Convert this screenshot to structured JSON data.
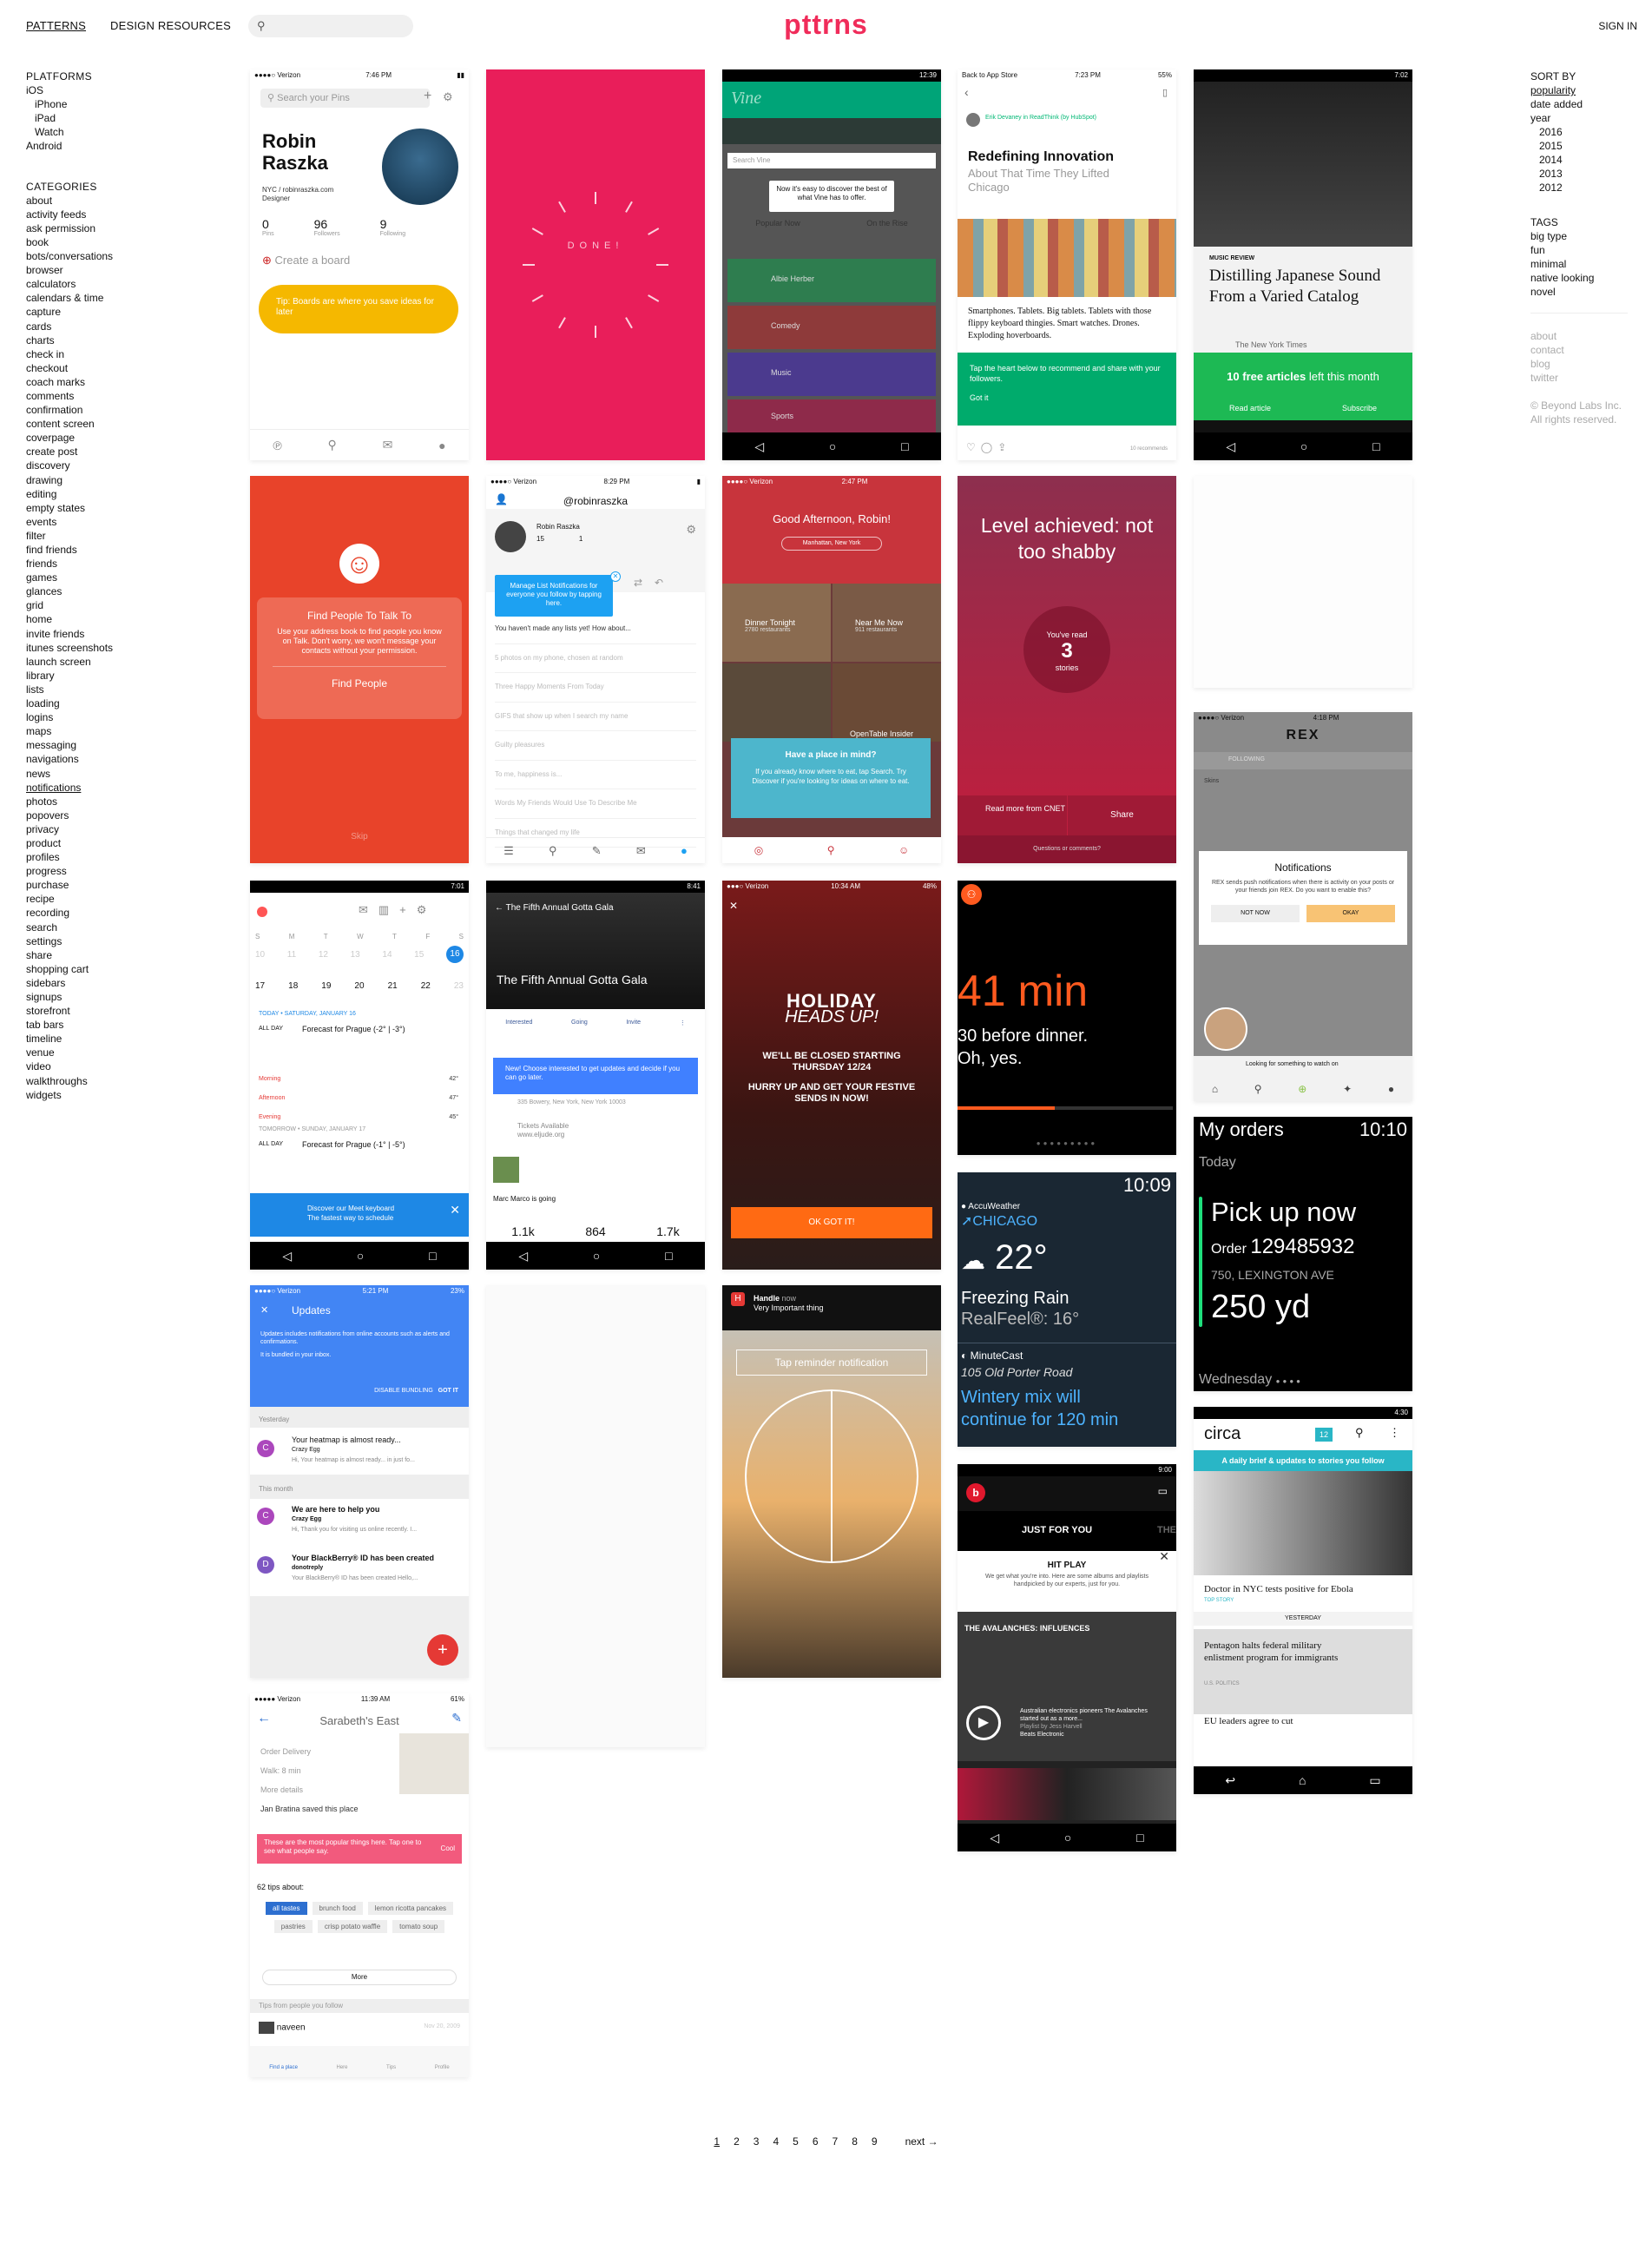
{
  "header": {
    "tab_patterns": "PATTERNS",
    "tab_resources": "DESIGN RESOURCES",
    "logo": "pttrns",
    "signin": "SIGN IN"
  },
  "platforms": {
    "heading": "PLATFORMS",
    "items": [
      "iOS",
      "iPhone",
      "iPad",
      "Watch",
      "Android"
    ]
  },
  "categories": {
    "heading": "CATEGORIES",
    "items": [
      "about",
      "activity feeds",
      "ask permission",
      "book",
      "bots/conversations",
      "browser",
      "calculators",
      "calendars & time",
      "capture",
      "cards",
      "charts",
      "check in",
      "checkout",
      "coach marks",
      "comments",
      "confirmation",
      "content screen",
      "coverpage",
      "create post",
      "discovery",
      "drawing",
      "editing",
      "empty states",
      "events",
      "filter",
      "find friends",
      "friends",
      "games",
      "glances",
      "grid",
      "home",
      "invite friends",
      "itunes screenshots",
      "launch screen",
      "library",
      "lists",
      "loading",
      "logins",
      "maps",
      "messaging",
      "navigations",
      "news",
      "notifications",
      "photos",
      "popovers",
      "privacy",
      "product",
      "profiles",
      "progress",
      "purchase",
      "recipe",
      "recording",
      "search",
      "settings",
      "share",
      "shopping cart",
      "sidebars",
      "signups",
      "storefront",
      "tab bars",
      "timeline",
      "venue",
      "video",
      "walkthroughs",
      "widgets"
    ],
    "selected": "notifications"
  },
  "sort": {
    "heading": "SORT BY",
    "items": [
      "popularity",
      "date added",
      "year"
    ],
    "years": [
      "2016",
      "2015",
      "2014",
      "2013",
      "2012"
    ]
  },
  "tags": {
    "heading": "TAGS",
    "items": [
      "big type",
      "fun",
      "minimal",
      "native looking",
      "novel"
    ]
  },
  "footer_links": [
    "about",
    "contact",
    "blog",
    "twitter"
  ],
  "copyright": [
    "© Beyond Labs Inc.",
    "All rights reserved."
  ],
  "pagination": {
    "pages": [
      "1",
      "2",
      "3",
      "4",
      "5",
      "6",
      "7",
      "8",
      "9"
    ],
    "next": "next →"
  },
  "colors": {
    "brand": "#f02c5a"
  },
  "shots": {
    "pinterest": {
      "time": "7:46 PM",
      "search": "Search your Pins",
      "name1": "Robin",
      "name2": "Raszka",
      "site": "NYC / robinraszka.com",
      "role": "Designer",
      "s1": "0",
      "s1l": "Pins",
      "s2": "96",
      "s2l": "Followers",
      "s3": "9",
      "s3l": "Following",
      "create": "Create a board",
      "tip": "Tip: Boards are where you save ideas for later"
    },
    "done": {
      "text": "DONE!"
    },
    "vine": {
      "time": "12:39",
      "search": "Search Vine",
      "tip": "Now it's easy to discover the best of what Vine has to offer.",
      "tab1": "Popular Now",
      "tab2": "On the Rise",
      "ch": [
        "Albie Herber",
        "Comedy",
        "Music",
        "Sports"
      ]
    },
    "medium": {
      "time": "7:23 PM",
      "back": "Back to App Store",
      "author": "Erik Devaney in ReadThink (by HubSpot)",
      "title": "Redefining Innovation",
      "sub": "About That Time They Lifted Chicago",
      "body": "Smartphones. Tablets. Big tablets. Tablets with those flippy keyboard thingies. Smart watches. Drones. Exploding hoverboards.",
      "tip": "Tap the heart below to recommend and share with your followers.",
      "got": "Got it",
      "rec": "10 recommends"
    },
    "nyt": {
      "time": "7:02",
      "kicker": "MUSIC REVIEW",
      "title": "Distilling Japanese Sound From a Varied Catalog",
      "src": "The New York Times",
      "banner1": "10 free articles",
      "banner2": "left this month",
      "read": "Read article",
      "sub": "Subscribe"
    },
    "talk": {
      "title": "Find People To Talk To",
      "body": "Use your address book to find people you know on Talk. Don't worry, we won't message your contacts without your permission.",
      "btn": "Find People",
      "skip": "Skip"
    },
    "twitter": {
      "time": "8:29 PM",
      "handle": "@robinraszka",
      "name": "Robin Raszka",
      "n1": "15",
      "n2": "1",
      "tip": "Manage List Notifications for everyone you follow by tapping here.",
      "lines": [
        "You haven't made any lists yet! How about...",
        "5 photos on my phone, chosen at random",
        "Three Happy Moments From Today",
        "GIFS that show up when I search my name",
        "Guilty pleasures",
        "To me, happiness is...",
        "Words My Friends Would Use To Describe Me",
        "Things that changed my life"
      ]
    },
    "opentable": {
      "time": "2:47 PM",
      "greet": "Good Afternoon, Robin!",
      "loc": "Manhattan, New York",
      "t1": "Dinner Tonight",
      "t1s": "2780 restaurants",
      "t2": "Near Me Now",
      "t2s": "911 restaurants",
      "t3": "OpenTable Insider",
      "tip1": "Have a place in mind?",
      "tip2": "If you already know where to eat, tap Search. Try Discover if you're looking for ideas on where to eat."
    },
    "cnet": {
      "title": "Level achieved: not too shabby",
      "read": "You've read",
      "num": "3",
      "stories": "stories",
      "more": "Read more from CNET",
      "share": "Share",
      "q": "Questions or comments?"
    },
    "calendar": {
      "time": "7:01",
      "days": [
        "S",
        "M",
        "T",
        "W",
        "T",
        "F",
        "S"
      ],
      "w1": [
        "10",
        "11",
        "12",
        "13",
        "14",
        "15",
        "16"
      ],
      "w2": [
        "17",
        "18",
        "19",
        "20",
        "21",
        "22",
        "23"
      ],
      "today": "TODAY • SATURDAY, JANUARY 16",
      "allday": "ALL DAY",
      "f1": "Forecast for Prague (-2° | -3°)",
      "m": "Morning",
      "a": "Afternoon",
      "e": "Evening",
      "t42": "42°",
      "t47": "47°",
      "t45": "45°",
      "tom": "TOMORROW • SUNDAY, JANUARY 17",
      "f2": "Forecast for Prague (-1° | -5°)",
      "tip1": "Discover our Meet keyboard",
      "tip2": "The fastest way to schedule"
    },
    "gala": {
      "time": "8:41",
      "title": "The Fifth Annual Gotta Gala",
      "header": "The Fifth Annual Gotta Gala",
      "o1": "Interested",
      "o2": "Going",
      "o3": "Invite",
      "tip": "New! Choose interested to get updates and decide if you can go later.",
      "addr": "335 Bowery, New York, New York 10003",
      "tickets": "Tickets Available",
      "url": "www.eljude.org",
      "marc": "Marc Marco is going",
      "c1": "1.1k",
      "c2": "864",
      "c3": "1.7k"
    },
    "holiday": {
      "time": "10:34 AM",
      "h1": "HOLIDAY",
      "h2": "HEADS UP!",
      "b1": "WE'LL BE CLOSED STARTING THURSDAY 12/24",
      "b2": "HURRY UP AND GET YOUR FESTIVE SENDS IN NOW!",
      "btn": "OK GOT IT!"
    },
    "rex": {
      "time": "4:18 PM",
      "title": "REX",
      "tab": "FOLLOWING",
      "skins": "Skins",
      "ntitle": "Notifications",
      "nbody": "REX sends push notifications when there is activity on your posts or your friends join REX. Do you want to enable this?",
      "no": "NOT NOW",
      "ok": "OKAY",
      "foot": "Looking for something to watch on"
    },
    "watch1": {
      "big": "41 min",
      "l1": "30 before dinner.",
      "l2": "Oh, yes."
    },
    "orders": {
      "title": "My orders",
      "time": "10:10",
      "today": "Today",
      "pick": "Pick up now",
      "order": "Order",
      "onum": "129485932",
      "addr": "750, LEXINGTON AVE",
      "dist": "250 yd",
      "day": "Wednesday"
    },
    "updates": {
      "time": "5:21 PM",
      "bar": "Updates",
      "info1": "Updates includes notifications from online accounts such as alerts and confirmations.",
      "info2": "It is bundled in your inbox.",
      "dis": "DISABLE BUNDLING",
      "got": "GOT IT",
      "yest": "Yesterday",
      "e1t": "Your heatmap is almost ready...",
      "e1f": "Crazy Egg",
      "e1b": "Hi, Your heatmap is almost ready... in just fo...",
      "month": "This month",
      "e2t": "We are here to help you",
      "e2f": "Crazy Egg",
      "e2b": "Hi, Thank you for visiting us online recently. I...",
      "e3t": "Your BlackBerry® ID has been created",
      "e3f": "donotreply",
      "e3b": "Your BlackBerry® ID has been created Hello,..."
    },
    "handle": {
      "app": "Handle",
      "now": "now",
      "msg": "Very Important thing",
      "tap": "Tap reminder notification"
    },
    "accu": {
      "time": "10:09",
      "brand": "AccuWeather",
      "city": "CHICAGO",
      "temp": "22°",
      "cond": "Freezing Rain",
      "feel": "RealFeel®: 16°",
      "mc": "MinuteCast",
      "addr": "105 Old Porter Road",
      "w1": "Wintery mix will",
      "w2": "continue for 120 min"
    },
    "beats": {
      "time": "9:00",
      "tab": "JUST FOR YOU",
      "tab2": "THE",
      "hp": "HIT PLAY",
      "hpb": "We get what you're into. Here are some albums and playlists handpicked by our experts, just for you.",
      "alb": "THE AVALANCHES: INFLUENCES",
      "cap": "Australian electronics pioneers The Avalanches started out as a more...",
      "by": "Playlist by Jess Harvell",
      "src": "Beats Electronic"
    },
    "circa": {
      "time": "4:30",
      "logo": "circa",
      "count": "12",
      "banner": "A daily brief & updates to stories you follow",
      "h1": "Doctor in NYC tests positive for Ebola",
      "tag1": "TOP STORY",
      "yest": "YESTERDAY",
      "h2": "Pentagon halts federal military enlistment program for immigrants",
      "tag2": "U.S. POLITICS",
      "h3": "EU leaders agree to cut"
    },
    "foursq": {
      "time": "11:39 AM",
      "title": "Sarabeth's East",
      "order": "Order Delivery",
      "walk": "Walk: 8 min",
      "more": "More details",
      "saved": "Jan Bratina saved this place",
      "tip": "These are the most popular things here. Tap one to see what people say.",
      "cool": "Cool",
      "tips": "62 tips about:",
      "chips": [
        "all tastes",
        "brunch food",
        "lemon ricotta pancakes",
        "pastries",
        "crisp potato waffle",
        "tomato soup"
      ],
      "morebtn": "More",
      "friends": "Tips from people you follow",
      "user": "naveen",
      "date": "Nov 20, 2009",
      "tabs": [
        "Find a place",
        "Here",
        "Tips",
        "Profile"
      ]
    }
  }
}
